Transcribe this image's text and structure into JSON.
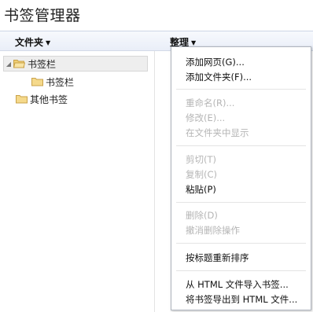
{
  "header": {
    "title": "书签管理器"
  },
  "toolbar": {
    "folders_label": "文件夹",
    "organize_label": "整理"
  },
  "tree": {
    "bookmarks_bar": "书签栏",
    "bookmarks_bar_child": "书签栏",
    "other_bookmarks": "其他书签"
  },
  "menu": {
    "items": [
      {
        "label": "添加网页(G)...",
        "enabled": true
      },
      {
        "label": "添加文件夹(F)...",
        "enabled": true
      },
      {
        "label": "重命名(R)...",
        "enabled": false
      },
      {
        "label": "修改(E)...",
        "enabled": false
      },
      {
        "label": "在文件夹中显示",
        "enabled": false
      },
      {
        "label": "剪切(T)",
        "enabled": false
      },
      {
        "label": "复制(C)",
        "enabled": false
      },
      {
        "label": "粘贴(P)",
        "enabled": true
      },
      {
        "label": "删除(D)",
        "enabled": false
      },
      {
        "label": "撤消删除操作",
        "enabled": false
      },
      {
        "label": "按标题重新排序",
        "enabled": true
      },
      {
        "label": "从 HTML 文件导入书签...",
        "enabled": true
      },
      {
        "label": "将书签导出到 HTML 文件...",
        "enabled": true
      }
    ]
  },
  "icons": {
    "folder": "folder-icon",
    "caret": "caret-down-icon",
    "tree_toggle": "tree-collapse-arrow-icon"
  },
  "colors": {
    "folder_fill": "#f5d98b",
    "folder_stroke": "#c9a24a",
    "disabled_text": "#b5b5b5",
    "toolbar_bg": "#e9eef8"
  }
}
